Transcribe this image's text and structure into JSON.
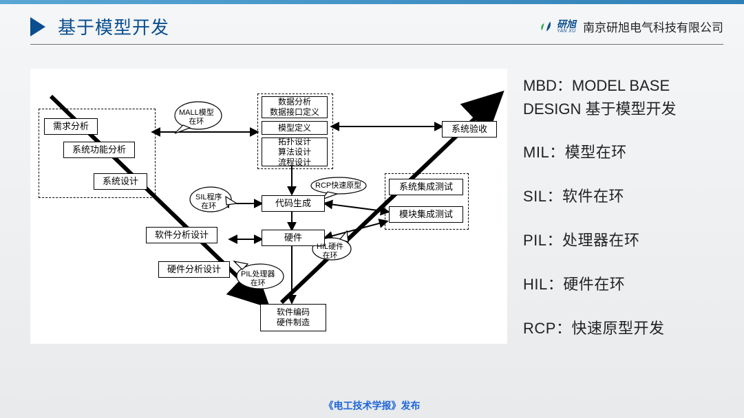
{
  "header": {
    "title": "基于模型开发",
    "logo": {
      "zh": "研旭",
      "en": "YAN XU"
    },
    "company": "南京研旭电气科技有限公司"
  },
  "side": {
    "mbd_label": "MBD：MODEL BASE DESIGN 基于模型开发",
    "items": [
      {
        "term": "MIL：",
        "def": "模型在环"
      },
      {
        "term": "SIL：",
        "def": "软件在环"
      },
      {
        "term": "PIL：",
        "def": "处理器在环"
      },
      {
        "term": "HIL：",
        "def": "硬件在环"
      },
      {
        "term": "RCP：",
        "def": "快速原型开发"
      }
    ]
  },
  "diagram": {
    "left_group": [
      "需求分析",
      "系统功能分析",
      "系统设计"
    ],
    "left_chain": [
      "软件分析设计",
      "硬件分析设计"
    ],
    "center_top": [
      "数据分析\n数据接口定义",
      "模型定义",
      "拓扑设计\n算法设计\n流程设计"
    ],
    "center_chain": [
      "代码生成",
      "硬件"
    ],
    "bottom": "软件编码\n硬件制造",
    "right_group": [
      "系统集成测试",
      "模块集成测试"
    ],
    "right_top": "系统验收",
    "callouts": {
      "mall": "MALL模型\n在环",
      "sil": "SIL程序\n在环",
      "pil": "PIL处理器\n在环",
      "rcp": "RCP快速原型",
      "hil": "HIL硬件\n在环"
    }
  },
  "footer": "《电工技术学报》发布"
}
